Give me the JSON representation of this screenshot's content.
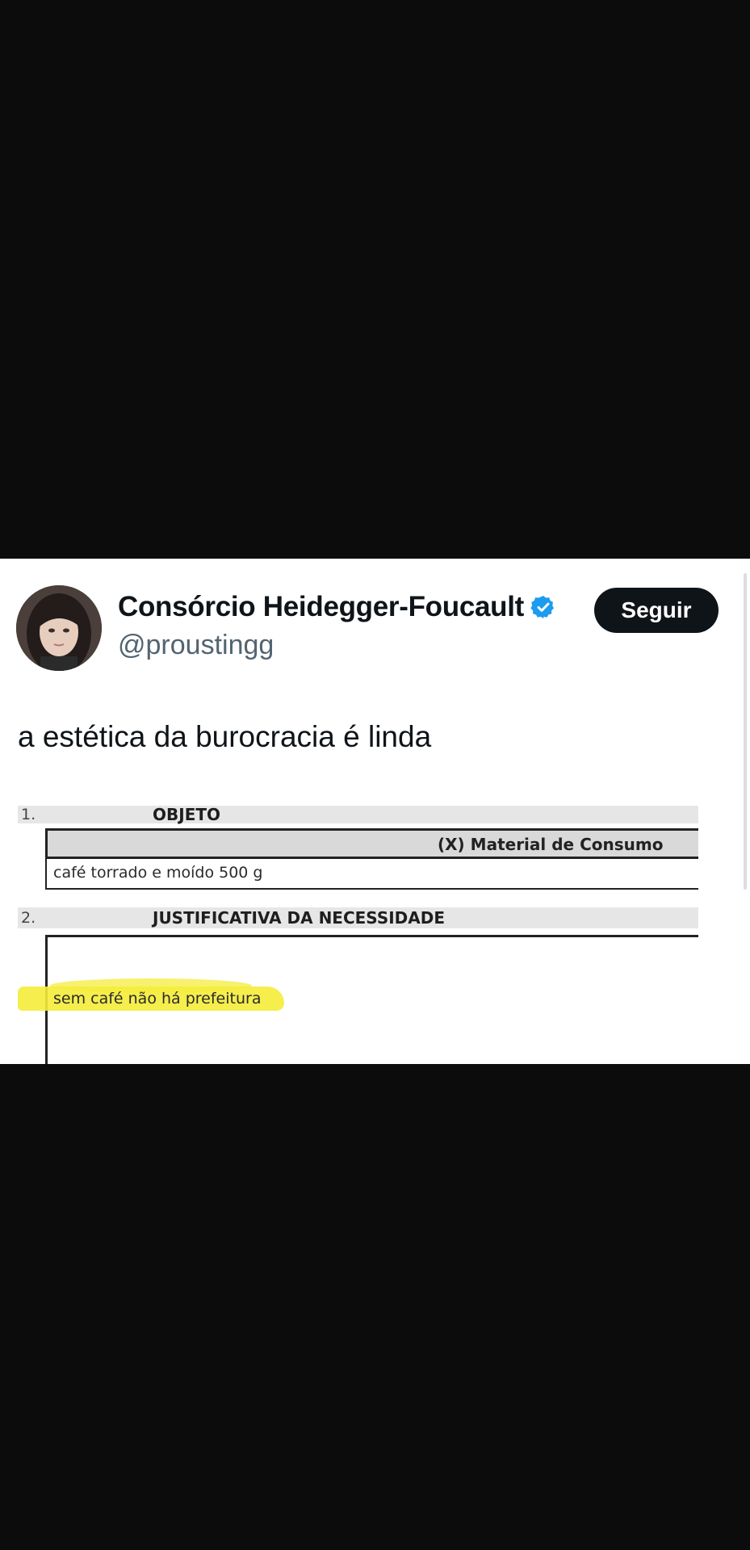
{
  "tweet": {
    "display_name": "Consórcio Heidegger-Foucault",
    "handle": "@proustingg",
    "follow_label": "Seguir",
    "text": "a estética da burocracia é linda",
    "verified_icon": "verified-badge-icon",
    "accent_color": "#1d9bf0"
  },
  "document": {
    "section1_number": "1.",
    "section1_title": "OBJETO",
    "material_label": "(X) Material de Consumo",
    "item_text": "café torrado e moído 500 g",
    "section2_number": "2.",
    "section2_title": "JUSTIFICATIVA DA NECESSIDADE",
    "justification_text": "sem café não há prefeitura"
  }
}
